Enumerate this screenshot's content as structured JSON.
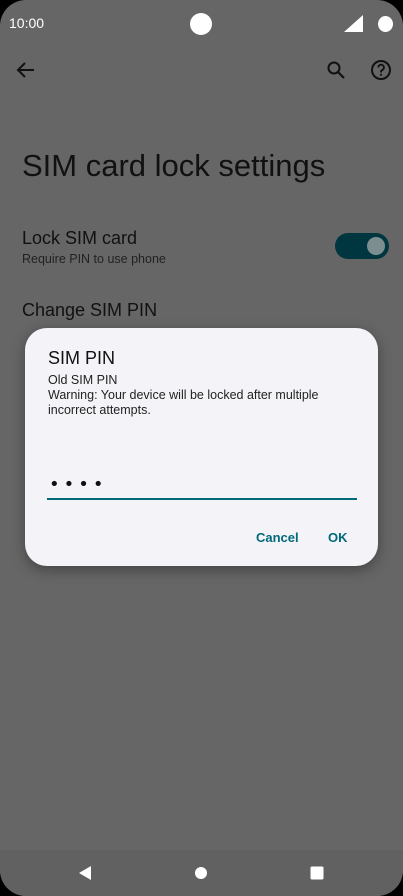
{
  "status_bar": {
    "time": "10:00"
  },
  "app_bar": {
    "back_icon": "arrow-back-icon",
    "search_icon": "search-icon",
    "help_icon": "help-icon"
  },
  "page": {
    "title": "SIM card lock settings",
    "lock_sim": {
      "title": "Lock SIM card",
      "subtitle": "Require PIN to use phone",
      "enabled": true
    },
    "change_pin": {
      "title": "Change SIM PIN"
    }
  },
  "dialog": {
    "title": "SIM PIN",
    "label": "Old SIM PIN",
    "warning": "Warning: Your device will be locked after multiple incorrect attempts.",
    "pin_value": "••••",
    "cancel_label": "Cancel",
    "ok_label": "OK",
    "accent": "#00697a"
  },
  "nav_bar": {
    "back_icon": "nav-back-icon",
    "home_icon": "nav-home-icon",
    "recents_icon": "nav-recents-icon"
  }
}
